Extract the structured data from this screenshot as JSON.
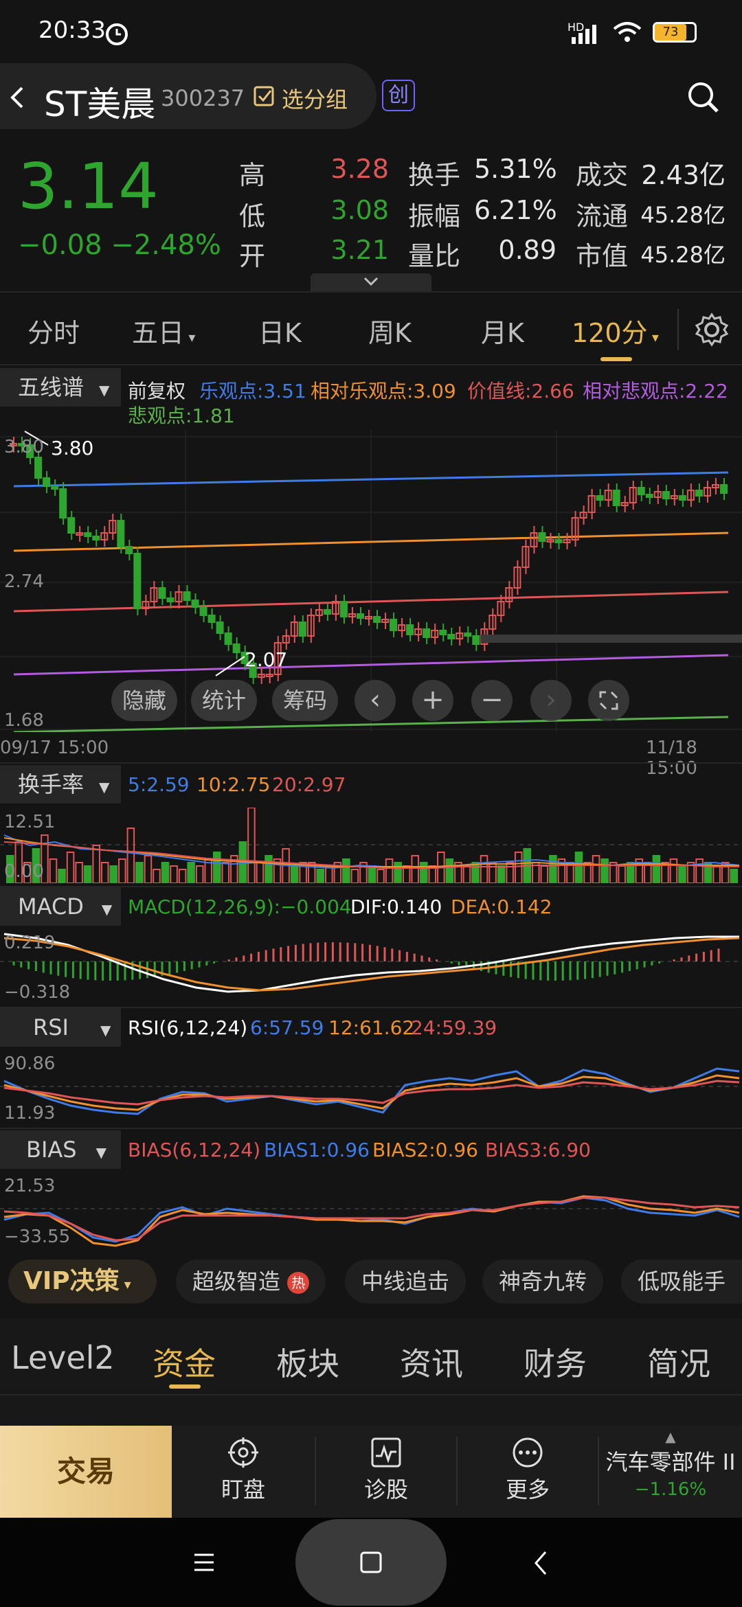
{
  "status": {
    "time": "20:33",
    "battery": "73",
    "signal_label": "HD"
  },
  "header": {
    "name": "ST美晨",
    "code": "300237",
    "group_label": "选分组",
    "board_badge": "创"
  },
  "quote": {
    "price": "3.14",
    "change": "−0.08",
    "change_pct": "−2.48%",
    "high_label": "高",
    "high": "3.28",
    "low_label": "低",
    "low": "3.08",
    "open_label": "开",
    "open": "3.21",
    "turnover_label": "换手",
    "turnover": "5.31%",
    "amplitude_label": "振幅",
    "amplitude": "6.21%",
    "volratio_label": "量比",
    "volratio": "0.89",
    "volume_label": "成交",
    "volume": "2.43亿",
    "float_label": "流通",
    "float": "45.28亿",
    "mktcap_label": "市值",
    "mktcap": "45.28亿"
  },
  "period_tabs": [
    "分时",
    "五日",
    "日K",
    "周K",
    "月K",
    "120分"
  ],
  "active_period": "120分",
  "main_chart": {
    "selector": "五线谱",
    "adjust": "前复权",
    "lines": [
      {
        "label": "乐观点:3.51",
        "color": "#3f7ce8"
      },
      {
        "label": "相对乐观点:3.09",
        "color": "#f0902e"
      },
      {
        "label": "价值线:2.66",
        "color": "#e05656"
      },
      {
        "label": "相对悲观点:2.22",
        "color": "#b35ce0"
      },
      {
        "label": "悲观点:1.81",
        "color": "#5ab04a"
      }
    ],
    "ymax_label": "3.80",
    "ymax_axis": "3.80",
    "ymid_axis": "2.74",
    "ymin_axis": "1.68",
    "low_marker": "2.07",
    "x_start": "09/17 15:00",
    "x_end": "11/18 15:00",
    "overlay_buttons": [
      "隐藏",
      "统计",
      "筹码"
    ]
  },
  "turnover": {
    "selector": "换手率",
    "ma": [
      {
        "label": "5:2.59",
        "color": "#3f7ce8"
      },
      {
        "label": "10:2.75",
        "color": "#f0902e"
      },
      {
        "label": "20:2.97",
        "color": "#e05656"
      }
    ],
    "ymax": "12.51",
    "ymin": "0.00"
  },
  "macd": {
    "selector": "MACD",
    "values": [
      {
        "label": "MACD(12,26,9):−0.004",
        "color": "#2ea52e"
      },
      {
        "label": "DIF:0.140",
        "color": "#ffffff"
      },
      {
        "label": "DEA:0.142",
        "color": "#f0902e"
      }
    ],
    "ymax": "0.219",
    "ymin": "−0.318"
  },
  "rsi": {
    "selector": "RSI",
    "values": [
      {
        "label": "RSI(6,12,24)",
        "color": "#ffffff"
      },
      {
        "label": "6:57.59",
        "color": "#3f7ce8"
      },
      {
        "label": "12:61.62",
        "color": "#f0902e"
      },
      {
        "label": "24:59.39",
        "color": "#e05656"
      }
    ],
    "ymax": "90.86",
    "ymin": "11.93"
  },
  "bias": {
    "selector": "BIAS",
    "values": [
      {
        "label": "BIAS(6,12,24)",
        "color": "#e05656"
      },
      {
        "label": "BIAS1:0.96",
        "color": "#3f7ce8"
      },
      {
        "label": "BIAS2:0.96",
        "color": "#f0902e"
      },
      {
        "label": "BIAS3:6.90",
        "color": "#e05656"
      }
    ],
    "ymax": "21.53",
    "ymin": "−33.55"
  },
  "strategy_strip": {
    "vip": "VIP决策",
    "chips": [
      "超级智造",
      "中线追击",
      "神奇九转",
      "低吸能手"
    ],
    "hot_badge": "热"
  },
  "info_tabs": [
    "Level2",
    "资金",
    "板块",
    "资讯",
    "财务",
    "简况"
  ],
  "active_info_tab": "资金",
  "bottom_nav": {
    "trade": "交易",
    "items": [
      "盯盘",
      "诊股",
      "更多"
    ],
    "sector": "汽车零部件 II",
    "sector_change": "−1.16%"
  }
}
